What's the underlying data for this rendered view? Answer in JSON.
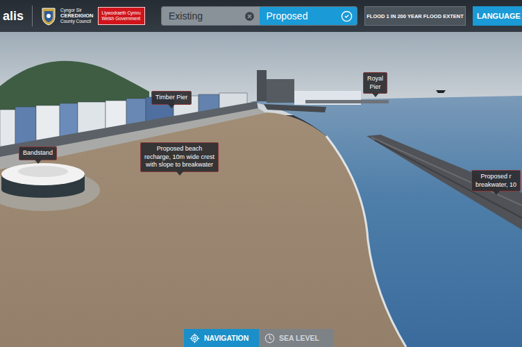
{
  "brand": {
    "logo": "alis",
    "council": [
      "Cyngor Sir",
      "CEREDIGION",
      "County Council"
    ],
    "government": [
      "Llywodraeth Cymru",
      "Welsh Government"
    ]
  },
  "scenario_toggle": [
    {
      "label": "Existing",
      "selected": false
    },
    {
      "label": "Proposed",
      "selected": true
    }
  ],
  "flood_button": {
    "label": "FLOOD 1 IN 200 YEAR FLOOD EXTENT",
    "selected": false
  },
  "language_button": {
    "label": "LANGUAGE"
  },
  "map_labels": [
    {
      "name": "timber-pier",
      "lines": [
        "Timber Pier"
      ]
    },
    {
      "name": "royal-pier",
      "lines": [
        "Royal",
        "Pier"
      ]
    },
    {
      "name": "bandstand",
      "lines": [
        "Bandstand"
      ]
    },
    {
      "name": "beach-recharge",
      "lines": [
        "Proposed beach",
        "recharge, 10m wide crest",
        "with slope to breakwater"
      ]
    },
    {
      "name": "breakwater",
      "lines": [
        "Proposed r",
        "breakwater, 10"
      ]
    }
  ],
  "bottom_tabs": [
    {
      "label": "NAVIGATION",
      "selected": true
    },
    {
      "label": "SEA LEVEL",
      "selected": false
    }
  ]
}
